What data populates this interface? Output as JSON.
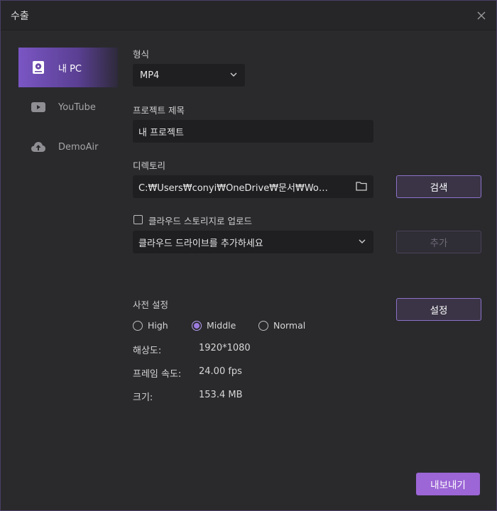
{
  "window": {
    "title": "수출"
  },
  "sidebar": {
    "items": [
      {
        "label": "내 PC",
        "icon": "hard-drive-icon",
        "active": true
      },
      {
        "label": "YouTube",
        "icon": "youtube-icon",
        "active": false
      },
      {
        "label": "DemoAir",
        "icon": "cloud-upload-icon",
        "active": false
      }
    ]
  },
  "format": {
    "label": "형식",
    "value": "MP4"
  },
  "project": {
    "label": "프로젝트 제목",
    "value": "내 프로젝트"
  },
  "directory": {
    "label": "디렉토리",
    "value": "C:₩Users₩conyi₩OneDrive₩문서₩Wo…",
    "browse_label": "검색"
  },
  "cloud": {
    "checkbox_label": "클라우드 스토리지로 업로드",
    "checked": false,
    "select_placeholder": "클라우드 드라이브를 추가하세요",
    "add_label": "추가"
  },
  "preset": {
    "label": "사전 설정",
    "settings_label": "설정",
    "options": [
      "High",
      "Middle",
      "Normal"
    ],
    "selected": "Middle"
  },
  "info": {
    "resolution_key": "해상도:",
    "resolution_value": "1920*1080",
    "framerate_key": "프레임 속도:",
    "framerate_value": "24.00 fps",
    "size_key": "크기:",
    "size_value": "153.4 MB"
  },
  "footer": {
    "export_label": "내보내기"
  },
  "colors": {
    "accent": "#9c66d6",
    "background": "#2a2a2d",
    "input": "#1f1f22"
  }
}
